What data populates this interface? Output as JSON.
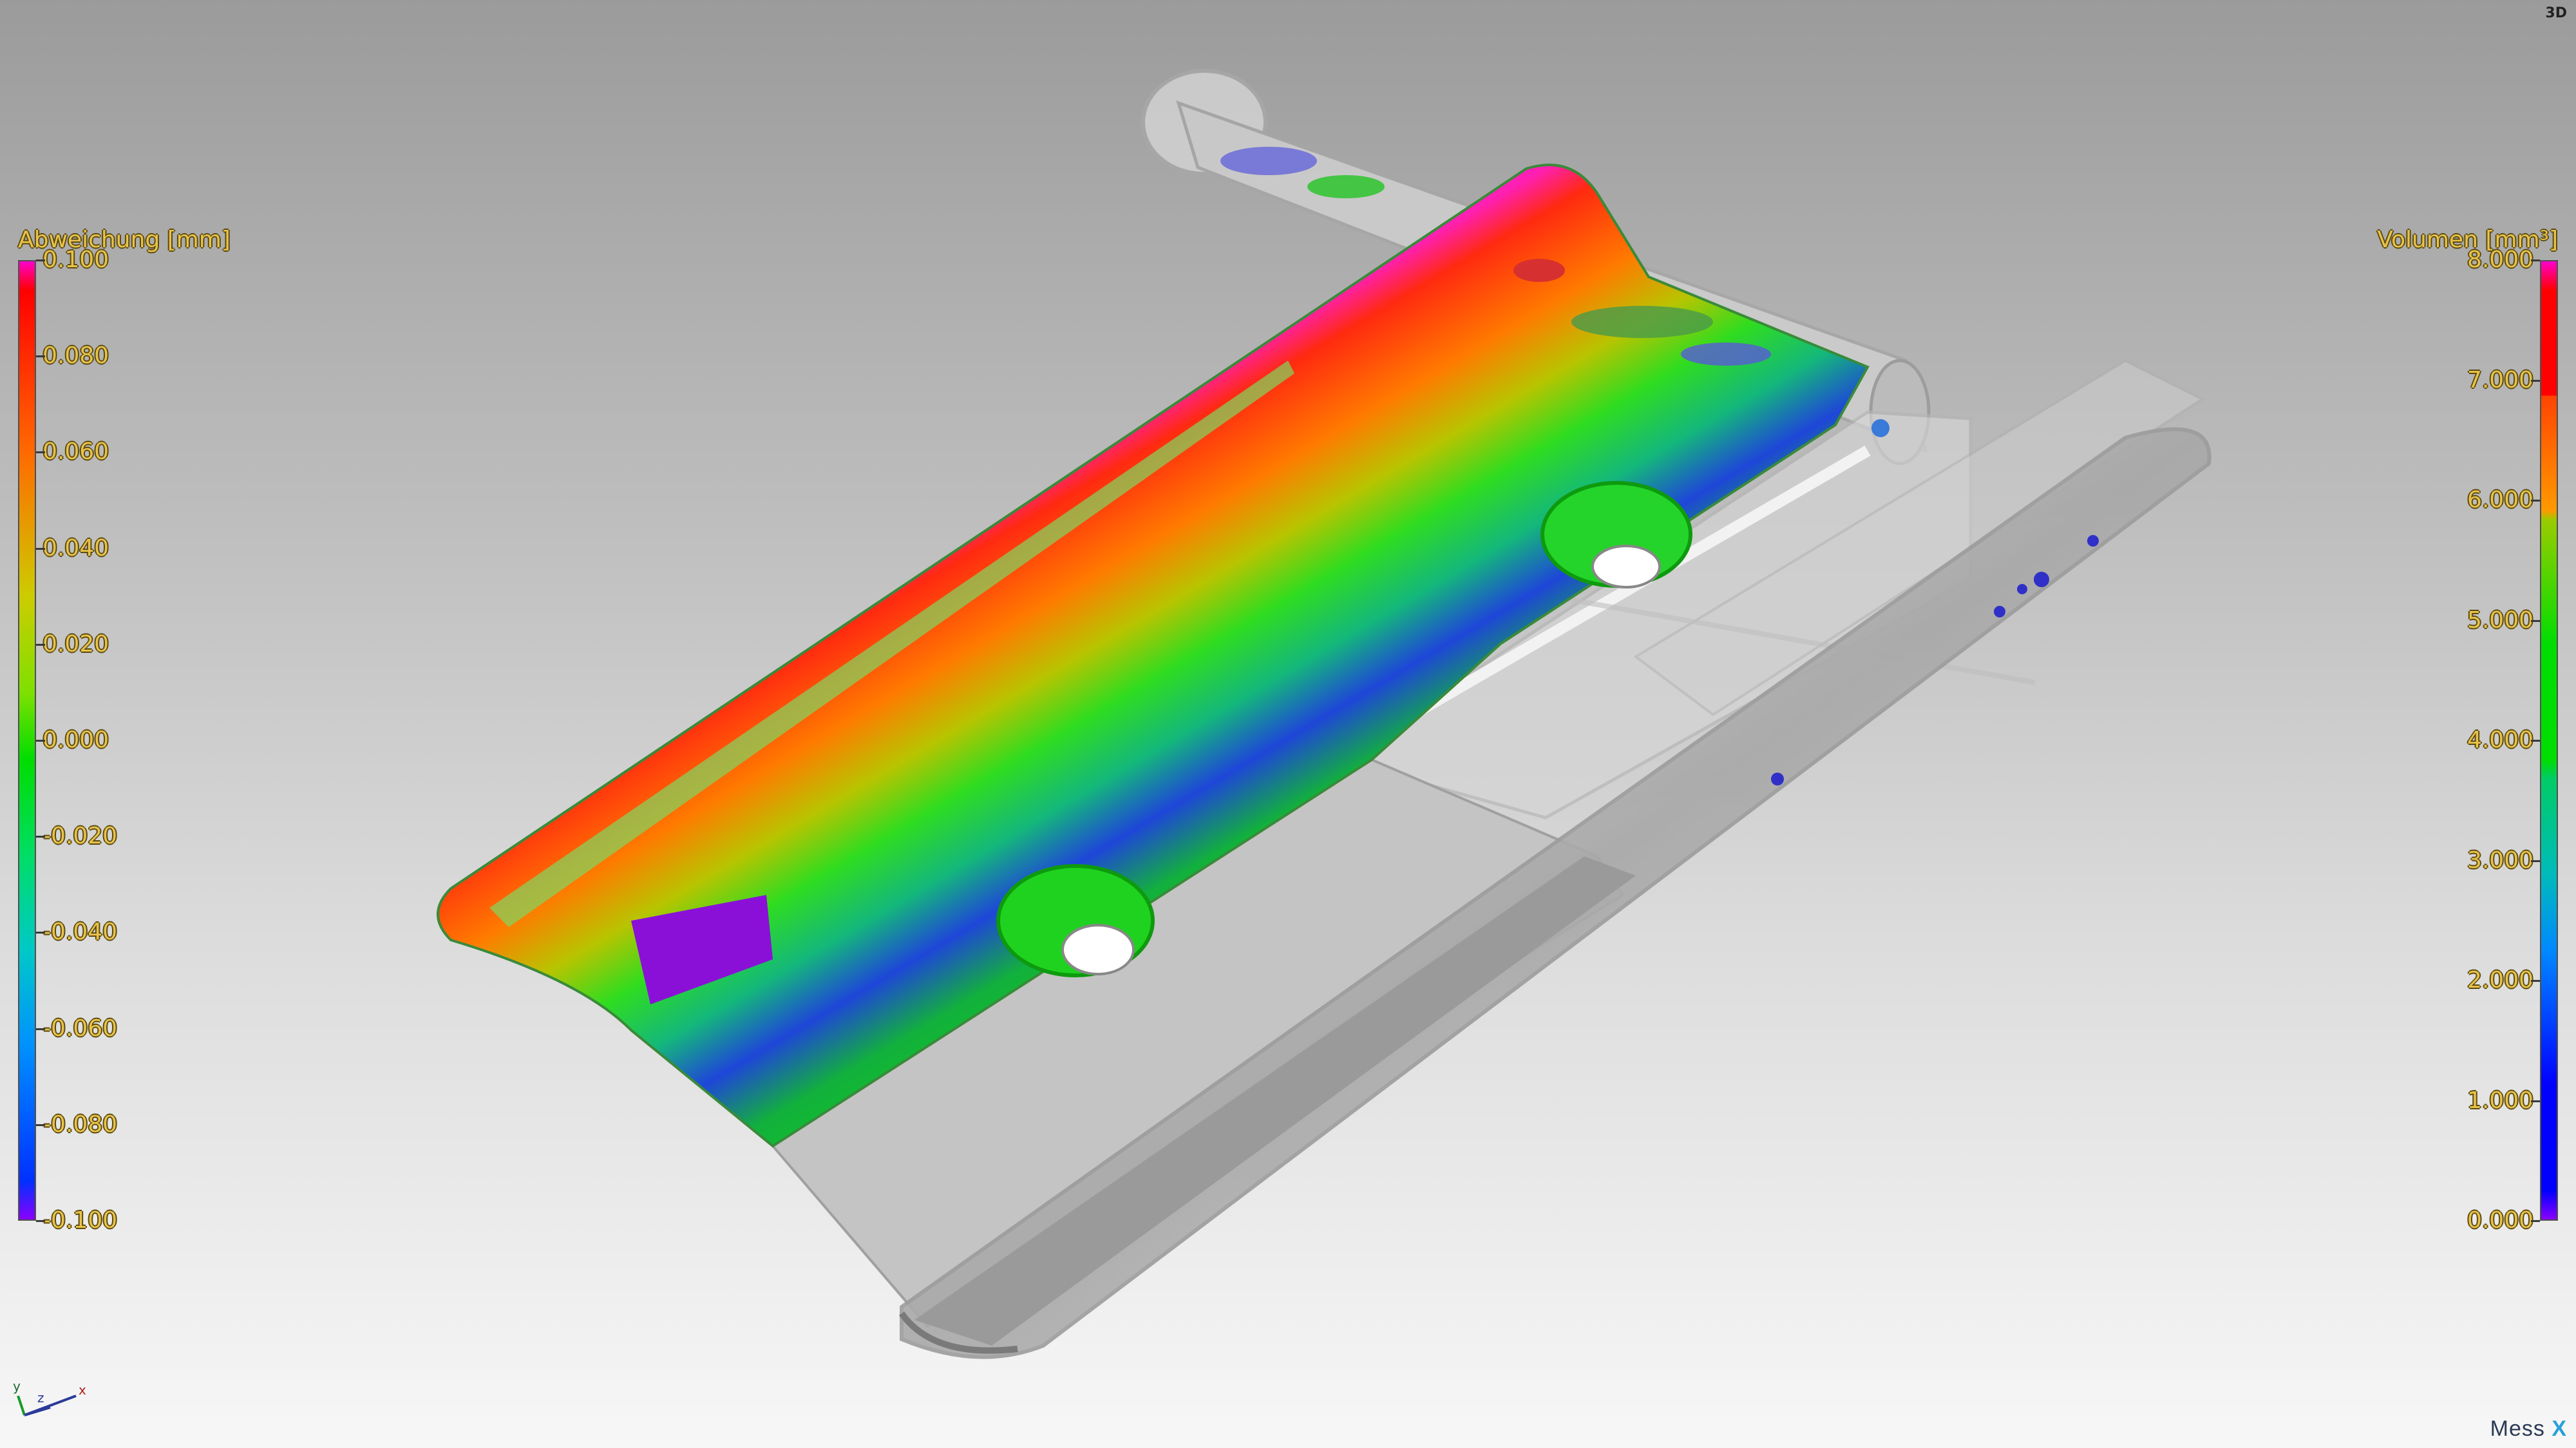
{
  "viewer": {
    "view_mode": "3D",
    "brand": "Mess",
    "brand_mark": "X"
  },
  "legend_left": {
    "title": "Abweichung [mm]",
    "ticks": [
      "0.100",
      "0.080",
      "0.060",
      "0.040",
      "0.020",
      "0.000",
      "-0.020",
      "-0.040",
      "-0.060",
      "-0.080",
      "-0.100"
    ],
    "gradient": [
      "#ff00cc",
      "#ff0000",
      "#ff6a00",
      "#cccc00",
      "#7fe000",
      "#00dd00",
      "#00dd66",
      "#00c8c8",
      "#0090ff",
      "#0030ff",
      "#8a00ff"
    ]
  },
  "legend_right": {
    "title": "Volumen [mm³]",
    "ticks": [
      "8.000",
      "7.000",
      "6.000",
      "5.000",
      "4.000",
      "3.000",
      "2.000",
      "1.000",
      "0.000"
    ],
    "gradient": [
      "#ff00cc",
      "#ff0000",
      "#ff4400",
      "#ff9900",
      "#99cc00",
      "#00dd00",
      "#00cc66",
      "#00bbbb",
      "#0088ff",
      "#0000ff",
      "#8a00ff"
    ]
  },
  "axes": {
    "x": "x",
    "y": "y",
    "z": "z"
  },
  "colors": {
    "part_gray": "#c8c8c8",
    "deviation_high": "#ff0000",
    "deviation_zero": "#00cc33",
    "deviation_low": "#1f3bd8"
  }
}
